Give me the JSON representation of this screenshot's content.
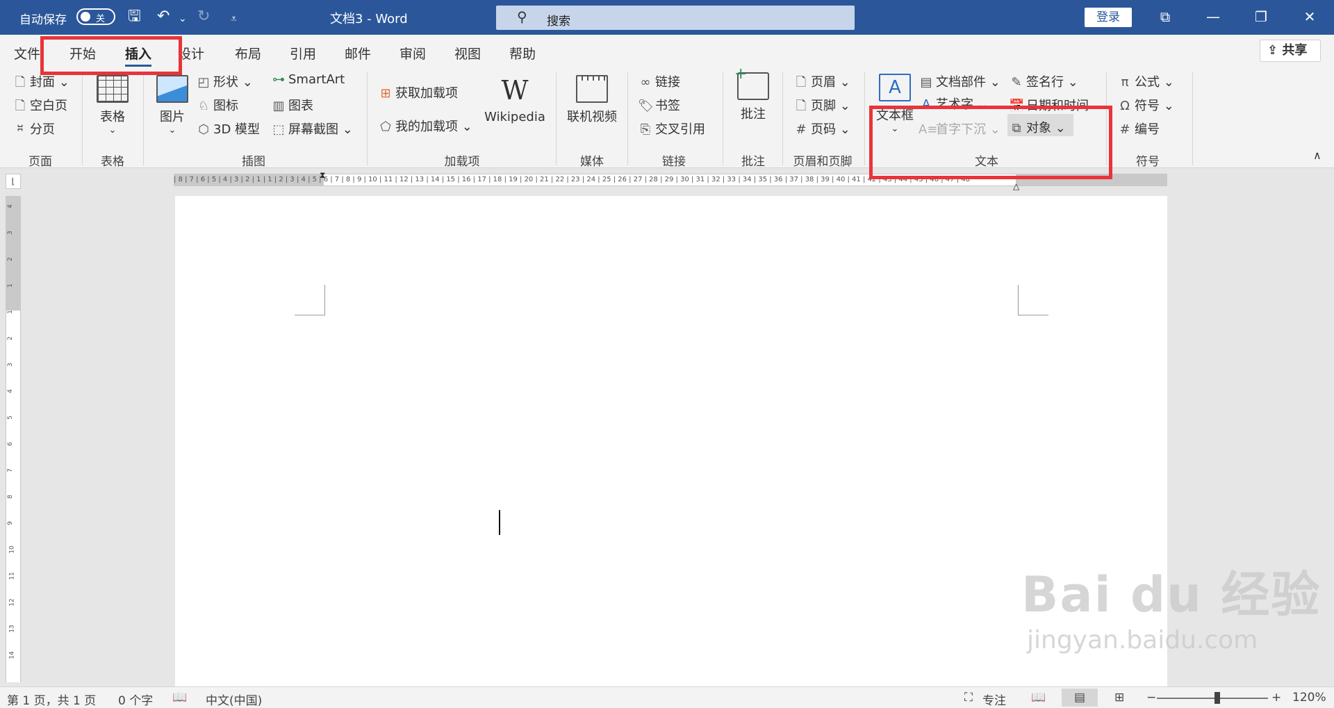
{
  "titlebar": {
    "autosave_label": "自动保存",
    "autosave_state": "关",
    "doc_title": "文档3  -  Word",
    "search_placeholder": "搜索",
    "login_label": "登录"
  },
  "tabs": [
    "文件",
    "开始",
    "插入",
    "设计",
    "布局",
    "引用",
    "邮件",
    "审阅",
    "视图",
    "帮助"
  ],
  "active_tab": "插入",
  "share_label": "共享",
  "ribbon": {
    "pages": {
      "cover": "封面",
      "blank": "空白页",
      "break": "分页",
      "group": "页面"
    },
    "tables": {
      "table": "表格",
      "group": "表格"
    },
    "illustrations": {
      "picture": "图片",
      "shapes": "形状",
      "icons": "图标",
      "model3d": "3D 模型",
      "smartart": "SmartArt",
      "chart": "图表",
      "screenshot": "屏幕截图",
      "group": "插图"
    },
    "addins": {
      "get": "获取加载项",
      "my": "我的加载项",
      "wikipedia": "Wikipedia",
      "group": "加载项"
    },
    "media": {
      "video": "联机视频",
      "group": "媒体"
    },
    "links": {
      "link": "链接",
      "bookmark": "书签",
      "crossref": "交叉引用",
      "group": "链接"
    },
    "comments": {
      "comment": "批注",
      "group": "批注"
    },
    "headerfooter": {
      "header": "页眉",
      "footer": "页脚",
      "pagenum": "页码",
      "group": "页眉和页脚"
    },
    "text": {
      "textbox": "文本框",
      "quickparts": "文档部件",
      "wordart": "艺术字",
      "dropcap": "首字下沉",
      "signature": "签名行",
      "datetime": "日期和时间",
      "object": "对象",
      "group": "文本"
    },
    "symbols": {
      "equation": "公式",
      "symbol": "符号",
      "number": "编号",
      "group": "符号"
    }
  },
  "status": {
    "page": "第 1 页，共 1 页",
    "words": "0 个字",
    "language": "中文(中国)",
    "focus": "专注",
    "zoom": "120%"
  },
  "watermark": {
    "line1": "Bai du 经验",
    "line2": "jingyan.baidu.com"
  },
  "colors": {
    "titlebar": "#2b579a",
    "highlight": "#e8343a",
    "ribbon_bg": "#f3f3f3"
  }
}
